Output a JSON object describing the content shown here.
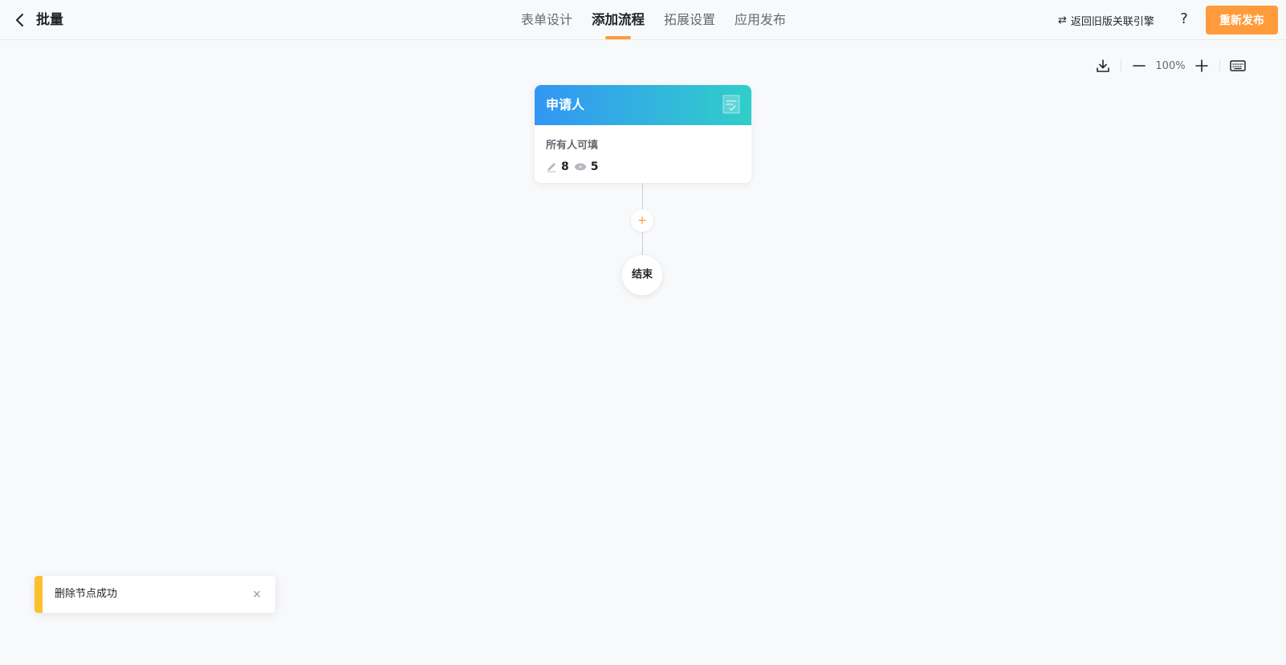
{
  "header": {
    "title": "批量",
    "back_icon": "chevron-left-icon",
    "tabs": [
      {
        "label": "表单设计",
        "active": false
      },
      {
        "label": "添加流程",
        "active": true
      },
      {
        "label": "拓展设置",
        "active": false
      },
      {
        "label": "应用发布",
        "active": false
      }
    ],
    "legacy_link": "返回旧版关联引擎",
    "legacy_icon": "swap-icon",
    "help_label": "?",
    "publish_label": "重新发布",
    "accent_color": "#ff9b3b"
  },
  "toolbar": {
    "zoom_level": "100%",
    "icons": [
      "download-icon",
      "zoom-out-icon",
      "zoom-in-icon",
      "keyboard-icon"
    ]
  },
  "canvas": {
    "applicant_node": {
      "title": "申请人",
      "description": "所有人可填",
      "edit_count": "8",
      "view_count": "5",
      "header_gradient": [
        "#3296f5",
        "#31cec9"
      ],
      "header_icon": "form-icon"
    },
    "add_button_label": "+",
    "end_node_label": "结束"
  },
  "toast": {
    "message": "删除节点成功",
    "close_label": "×",
    "accent_color": "#fbc02d"
  }
}
